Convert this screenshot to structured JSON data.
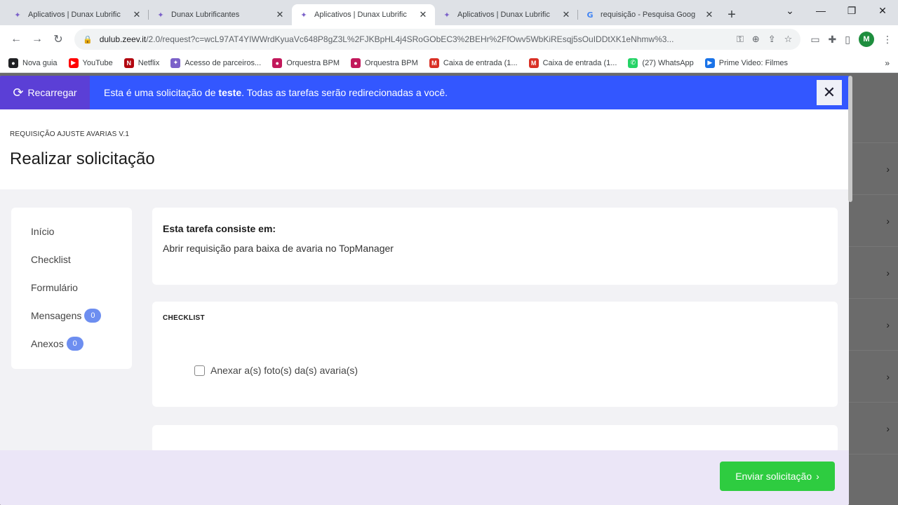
{
  "browser": {
    "tabs": [
      {
        "title": "Aplicativos | Dunax Lubrific",
        "icon": "zeev-icon",
        "active": false
      },
      {
        "title": "Dunax Lubrificantes",
        "icon": "zeev-icon",
        "active": false
      },
      {
        "title": "Aplicativos | Dunax Lubrific",
        "icon": "zeev-icon",
        "active": true
      },
      {
        "title": "Aplicativos | Dunax Lubrific",
        "icon": "zeev-icon",
        "active": false
      },
      {
        "title": "requisição - Pesquisa Goog",
        "icon": "google-icon",
        "active": false
      }
    ],
    "url_host": "dulub.zeev.it",
    "url_path": "/2.0/request?c=wcL97AT4YIWWrdKyuaVc648P8gZ3L%2FJKBpHL4j4SRoGObEC3%2BEHr%2FfOwv5WbKiREsqj5sOuIDDtXK1eNhmw%3...",
    "bookmarks": [
      {
        "label": "Nova guia",
        "color": "#202124"
      },
      {
        "label": "YouTube",
        "color": "#ff0000"
      },
      {
        "label": "Netflix",
        "color": "#b20710"
      },
      {
        "label": "Acesso de parceiros...",
        "color": "#7b61c9"
      },
      {
        "label": "Orquestra BPM",
        "color": "#c2185b"
      },
      {
        "label": "Orquestra BPM",
        "color": "#c2185b"
      },
      {
        "label": "Caixa de entrada (1...",
        "color": "#d93025"
      },
      {
        "label": "Caixa de entrada (1...",
        "color": "#d93025"
      },
      {
        "label": "(27) WhatsApp",
        "color": "#25d366"
      },
      {
        "label": "Prime Video: Filmes",
        "color": "#1a73e8"
      }
    ],
    "avatar_letter": "M"
  },
  "banner": {
    "reload_label": "Recarregar",
    "text_before": "Esta é uma solicitação de ",
    "text_bold": "teste",
    "text_after": ". Todas as tarefas serão redirecionadas a você."
  },
  "header": {
    "breadcrumb": "REQUISIÇÃO AJUSTE AVARIAS V.1",
    "title": "Realizar solicitação"
  },
  "leftnav": {
    "items": [
      {
        "label": "Início"
      },
      {
        "label": "Checklist"
      },
      {
        "label": "Formulário"
      },
      {
        "label": "Mensagens",
        "badge": "0"
      },
      {
        "label": "Anexos",
        "badge": "0"
      }
    ]
  },
  "task": {
    "heading": "Esta tarefa consiste em:",
    "description": "Abrir requisição para baixa de avaria no TopManager"
  },
  "checklist": {
    "heading": "CHECKLIST",
    "items": [
      {
        "label": "Anexar a(s) foto(s) da(s) avaria(s)",
        "checked": false
      }
    ]
  },
  "footer": {
    "submit_label": "Enviar solicitação"
  },
  "colors": {
    "banner": "#3357ff",
    "reload": "#5b3fd6",
    "submit": "#2ecc40",
    "badge": "#6d8ef0"
  }
}
